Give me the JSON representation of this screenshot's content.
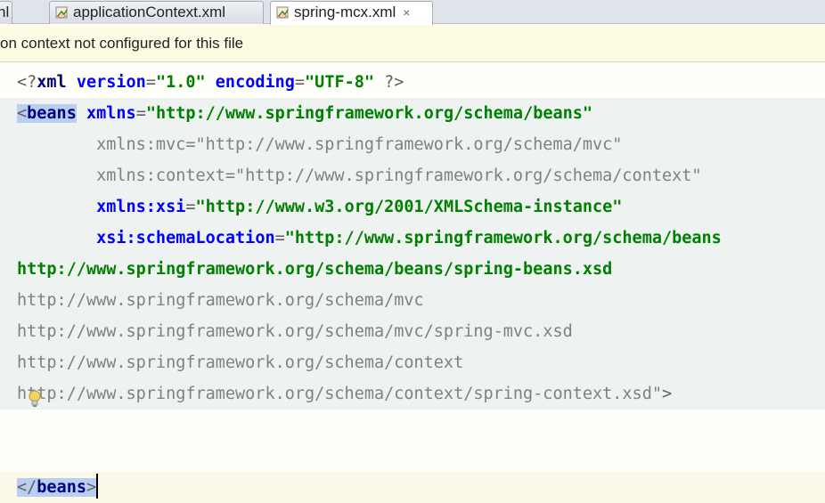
{
  "tabs": [
    {
      "label": "nl",
      "icon": "none",
      "active": false
    },
    {
      "label": "applicationContext.xml",
      "icon": "spring-xml-icon",
      "active": false
    },
    {
      "label": "spring-mcx.xml",
      "icon": "spring-xml-icon",
      "active": true,
      "close": "×"
    }
  ],
  "banner": {
    "text": "on context not configured for this file"
  },
  "editor": {
    "lines": [
      [
        {
          "t": "<?",
          "c": "punc"
        },
        {
          "t": "xml ",
          "c": "tag"
        },
        {
          "t": "version",
          "c": "attr"
        },
        {
          "t": "=",
          "c": "punc"
        },
        {
          "t": "\"1.0\"",
          "c": "val"
        },
        {
          "t": " ",
          "c": "punc"
        },
        {
          "t": "encoding",
          "c": "attr"
        },
        {
          "t": "=",
          "c": "punc"
        },
        {
          "t": "\"UTF-8\"",
          "c": "val"
        },
        {
          "t": " ?>",
          "c": "punc"
        }
      ],
      [
        {
          "t": "<",
          "c": "punc hl"
        },
        {
          "t": "beans",
          "c": "tag hl"
        },
        {
          "t": " ",
          "c": "punc"
        },
        {
          "t": "xmlns",
          "c": "attr"
        },
        {
          "t": "=",
          "c": "punc"
        },
        {
          "t": "\"http://www.springframework.org/schema/beans\"",
          "c": "val"
        }
      ],
      [
        {
          "t": "        xmlns:mvc=\"http://www.springframework.org/schema/mvc\"",
          "c": "gray"
        }
      ],
      [
        {
          "t": "        xmlns:context=\"http://www.springframework.org/schema/context\"",
          "c": "gray"
        }
      ],
      [
        {
          "t": "        ",
          "c": "punc"
        },
        {
          "t": "xmlns:xsi",
          "c": "attr"
        },
        {
          "t": "=",
          "c": "punc"
        },
        {
          "t": "\"http://www.w3.org/2001/XMLSchema-instance\"",
          "c": "val"
        }
      ],
      [
        {
          "t": "        ",
          "c": "punc"
        },
        {
          "t": "xsi:schemaLocation",
          "c": "attr"
        },
        {
          "t": "=",
          "c": "punc"
        },
        {
          "t": "\"http://www.springframework.org/schema/beans",
          "c": "val"
        }
      ],
      [
        {
          "t": "http://www.springframework.org/schema/beans/spring-beans.xsd",
          "c": "val"
        }
      ],
      [
        {
          "t": "http://www.springframework.org/schema/mvc",
          "c": "gray"
        }
      ],
      [
        {
          "t": "http://www.springframework.org/schema/mvc/spring-mvc.xsd",
          "c": "gray"
        }
      ],
      [
        {
          "t": "http://www.springframework.org/schema/context",
          "c": "gray"
        }
      ],
      [
        {
          "t": "http://www.springframework.org/schema/context/spring-context.xsd\"",
          "c": "gray"
        },
        {
          "t": ">",
          "c": "punc"
        }
      ],
      [],
      [],
      [
        {
          "t": "</",
          "c": "punc hl"
        },
        {
          "t": "beans",
          "c": "tag hl"
        },
        {
          "t": ">",
          "c": "punc hl"
        }
      ]
    ]
  }
}
